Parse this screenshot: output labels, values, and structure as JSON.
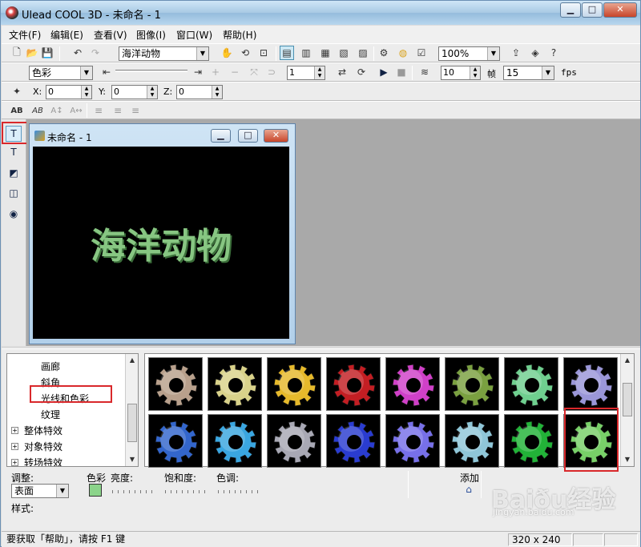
{
  "window": {
    "title": "Ulead COOL 3D - 未命名 - 1",
    "min": "▁",
    "max": "□",
    "close": "✕"
  },
  "menu": [
    "文件(F)",
    "编辑(E)",
    "查看(V)",
    "图像(I)",
    "窗口(W)",
    "帮助(H)"
  ],
  "toolbar1": {
    "text_combo": "海洋动物",
    "zoom_combo": "100%"
  },
  "toolbar2": {
    "attr_combo": "色彩",
    "frame_value": "1",
    "frames_value": "10",
    "frame_label": "帧",
    "fps_value": "15",
    "fps_label": "fps"
  },
  "toolbar3": {
    "x_label": "X:",
    "x_value": "0",
    "y_label": "Y:",
    "y_value": "0",
    "z_label": "Z:",
    "z_value": "0"
  },
  "toolbar4": [
    "AB",
    "AB",
    "A↕",
    "A↔"
  ],
  "child": {
    "title": "未命名 - 1",
    "canvas_text": "海洋动物"
  },
  "tree": {
    "items": [
      "画廊",
      "斜角",
      "光线和色彩",
      "纹理",
      "整体特效",
      "对象特效",
      "转场特效"
    ]
  },
  "gallery": {
    "thumbs": [
      {
        "color": "#b8a08c"
      },
      {
        "color": "#d9d28a"
      },
      {
        "color": "#e6b92b"
      },
      {
        "color": "#c31e23"
      },
      {
        "color": "#d040c8"
      },
      {
        "color": "#7aa040"
      },
      {
        "color": "#6fcf8f"
      },
      {
        "color": "#9a96d8"
      },
      {
        "color": "#3366cc"
      },
      {
        "color": "#3aa6e0"
      },
      {
        "color": "#a8a8b4"
      },
      {
        "color": "#2a3cd0"
      },
      {
        "color": "#7770e8"
      },
      {
        "color": "#8fc6d8"
      },
      {
        "color": "#22b238"
      },
      {
        "color": "#78d068"
      }
    ]
  },
  "panel": {
    "adjust_label": "调整:",
    "adjust_value": "表面",
    "color_label": "色彩",
    "brightness_label": "亮度:",
    "saturation_label": "饱和度:",
    "hue_label": "色调:",
    "add_label": "添加",
    "style_label": "样式:"
  },
  "status": {
    "help": "要获取「帮助」，请按 F1 键",
    "size": "320 x 240"
  },
  "watermark": {
    "brand": "Baiðu经验",
    "url": "jingyan.baidu.com"
  }
}
